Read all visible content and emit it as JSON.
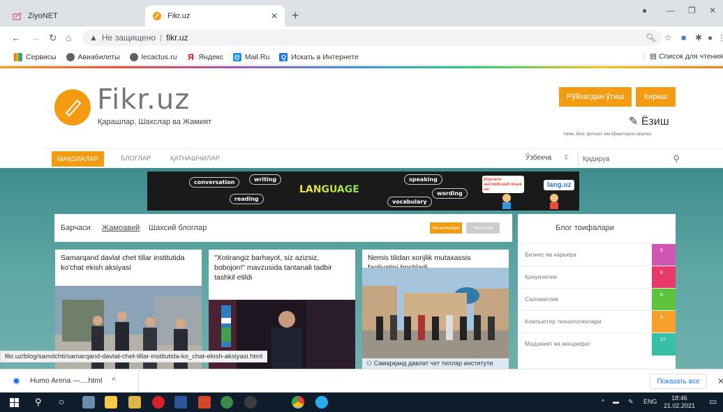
{
  "browser": {
    "tabs": [
      {
        "title": "ZiyoNET",
        "active": false
      },
      {
        "title": "Fikr.uz",
        "active": true
      }
    ],
    "omnibox": {
      "security": "Не защищено",
      "host": "fikr.uz"
    },
    "bookmarks": [
      {
        "label": "Сервисы",
        "icon": "apps-icon",
        "color": "#e8453c"
      },
      {
        "label": "Авиабилеты",
        "icon": "globe-icon",
        "color": "#5f6368"
      },
      {
        "label": "lecactus.ru",
        "icon": "globe-icon",
        "color": "#5f6368"
      },
      {
        "label": "Яндекс",
        "icon": "yandex-icon",
        "color": "#ff0000"
      },
      {
        "label": "Mail.Ru",
        "icon": "mailru-icon",
        "color": "#168de2"
      },
      {
        "label": "Искать в Интернете",
        "icon": "search-icon",
        "color": "#1a73e8"
      }
    ],
    "reading_list": "Список для чтения",
    "status_url": "fikr.uz/blog/samdchti/samarqand-davlat-chet-tillar-institutida-ko_chat-ekish-aksiyasi.html"
  },
  "site": {
    "logo_title": "Fikr.uz",
    "tagline": "Қарашлар, Шахслар ва Жамият",
    "register_label": "Рўйхатдан ўтиш",
    "login_label": "Кириш",
    "write_label": "Ёзиш",
    "write_sub": "топик, блог, фотосет ёки йўналтиргич яратиш",
    "nav": [
      {
        "label": "МАҚОЛАЛАР",
        "active": true
      },
      {
        "label": "БЛОГЛАР",
        "active": false
      },
      {
        "label": "ҚАТНАШЧИЛАР",
        "active": false
      }
    ],
    "language": "Ўзбекча",
    "search_placeholder": "Қидирув",
    "banner": {
      "words": [
        "conversation",
        "writing",
        "reading",
        "speaking",
        "wording",
        "vocabulary"
      ],
      "title": "LANGUAGE",
      "promo": "Изучате английский язык на",
      "brand": "lang.uz"
    },
    "feed_tabs": [
      "Барчаси",
      "Жамоавий",
      "Шахсий блоглар"
    ],
    "feed_buttons": [
      "Янгиликлари",
      "Янгилари"
    ],
    "cards": [
      {
        "title": "Samarqand davlat chet tillar institutida ko'chat ekish aksiyasi"
      },
      {
        "title": "\"Xotirangiz barhayot, siz azizsiz, bobojon!\" mavzusida tantanali tadbir tashkil etildi"
      },
      {
        "title": "Nemis tilidan xorijlik mutaxassis faoliyatini boshladi",
        "caption": "Самарқанд давлат чет тиллар институти"
      }
    ],
    "categories_title": "Блог тоифалари",
    "categories": [
      {
        "name": "Бизнес ва карьера",
        "count": "5",
        "color": "#d056b4"
      },
      {
        "name": "Қонунчилик",
        "count": "8",
        "color": "#e8396a"
      },
      {
        "name": "Саломатлик",
        "count": "8",
        "color": "#5cc33b"
      },
      {
        "name": "Компьютер технологиялари",
        "count": "8",
        "color": "#f4a02b"
      },
      {
        "name": "Маданият ва маърифат",
        "count": "27",
        "color": "#36c0a6"
      }
    ]
  },
  "downloads": {
    "file": "Humo Arena —....html",
    "show_all": "Показать все"
  },
  "taskbar": {
    "lang": "ENG",
    "time": "18:46",
    "date": "21.02.2021"
  }
}
